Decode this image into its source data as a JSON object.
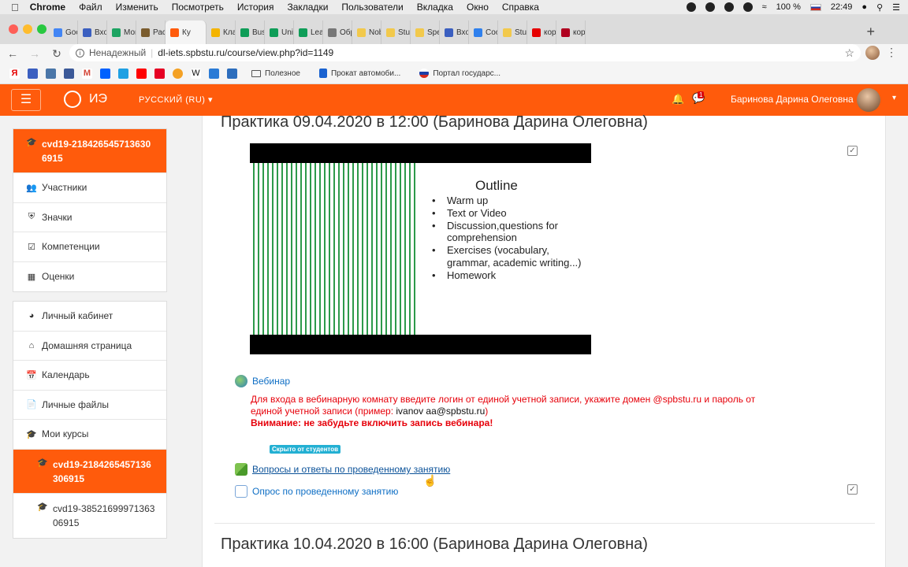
{
  "mac_menubar": {
    "app": "Chrome",
    "menus": [
      "Файл",
      "Изменить",
      "Посмотреть",
      "История",
      "Закладки",
      "Пользователи",
      "Вкладка",
      "Окно",
      "Справка"
    ],
    "battery": "100 %",
    "time": "22:49"
  },
  "browser": {
    "tabs": [
      {
        "label": "Goog",
        "color": "#4285f4"
      },
      {
        "label": "Вход",
        "color": "#3b5fc0"
      },
      {
        "label": "Мои",
        "color": "#1da462"
      },
      {
        "label": "Расп",
        "color": "#7a5c2e"
      },
      {
        "label": "Ку",
        "color": "#ff5b0c",
        "active": true
      },
      {
        "label": "Класс",
        "color": "#f4b400"
      },
      {
        "label": "Busin",
        "color": "#0f9d58"
      },
      {
        "label": "Unit",
        "color": "#0f9d58"
      },
      {
        "label": "Learn",
        "color": "#0f9d58"
      },
      {
        "label": "Обра",
        "color": "#777777"
      },
      {
        "label": "Nobe",
        "color": "#f2c94c"
      },
      {
        "label": "Stude",
        "color": "#f2c94c"
      },
      {
        "label": "Spea",
        "color": "#f2c94c"
      },
      {
        "label": "Вход",
        "color": "#3b5fc0"
      },
      {
        "label": "Сооб",
        "color": "#2f80ed"
      },
      {
        "label": "Stud",
        "color": "#f2c94c"
      },
      {
        "label": "корп",
        "color": "#e60000"
      },
      {
        "label": "кор",
        "color": "#b00020"
      }
    ],
    "security_label": "Ненадежный",
    "url": "dl-iets.spbstu.ru/course/view.php?id=1149",
    "bookmarks": [
      {
        "label": "Полезное"
      },
      {
        "label": "Прокат автомоби..."
      },
      {
        "label": "Портал государс..."
      }
    ]
  },
  "navbar": {
    "logo_text": "ИЭ",
    "language": "РУССКИЙ (RU)",
    "message_count": "1",
    "user_name": "Баринова Дарина Олеговна",
    "brand_color": "#ff5b0c"
  },
  "sidebar": {
    "course_block": [
      {
        "label": "cvd19-2184265457136306915",
        "icon": "graduation-cap-icon",
        "active": true
      },
      {
        "label": "Участники",
        "icon": "users-icon"
      },
      {
        "label": "Значки",
        "icon": "shield-icon"
      },
      {
        "label": "Компетенции",
        "icon": "checkbox-icon"
      },
      {
        "label": "Оценки",
        "icon": "table-icon"
      }
    ],
    "site_block": [
      {
        "label": "Личный кабинет",
        "icon": "dashboard-icon"
      },
      {
        "label": "Домашняя страница",
        "icon": "home-icon"
      },
      {
        "label": "Календарь",
        "icon": "calendar-icon"
      },
      {
        "label": "Личные файлы",
        "icon": "file-icon"
      },
      {
        "label": "Мои курсы",
        "icon": "graduation-cap-icon"
      },
      {
        "label": "cvd19-2184265457136306915",
        "icon": "graduation-cap-icon",
        "active": true
      },
      {
        "label": "cvd19-3852169997136306915",
        "icon": "graduation-cap-icon"
      }
    ]
  },
  "main": {
    "section1_title": "Практика 09.04.2020 в 12:00 (Баринова Дарина Олеговна)",
    "slide": {
      "title": "Outline",
      "items": [
        "Warm up",
        "Text or Video",
        "Discussion,questions for comprehension",
        "Exercises (vocabulary, grammar, academic writing...)",
        "Homework"
      ]
    },
    "webinar_link": "Вебинар",
    "notice_line1": "Для входа в вебинарную комнату введите логин от единой учетной записи, укажите домен @spbstu.ru и пароль от",
    "notice_line2_prefix": "единой учетной записи (пример: ",
    "notice_example": "ivanov  aa@spbstu.ru",
    "notice_line2_suffix": ")",
    "notice_warning": "Внимание: не забудьте включить запись вебинара!",
    "hidden_badge": "Скрыто от студентов",
    "forum_link": "Вопросы и ответы по проведенному занятию",
    "survey_link": "Опрос по проведенному занятию",
    "section2_title": "Практика 10.04.2020 в 16:00 (Баринова Дарина Олеговна)"
  }
}
